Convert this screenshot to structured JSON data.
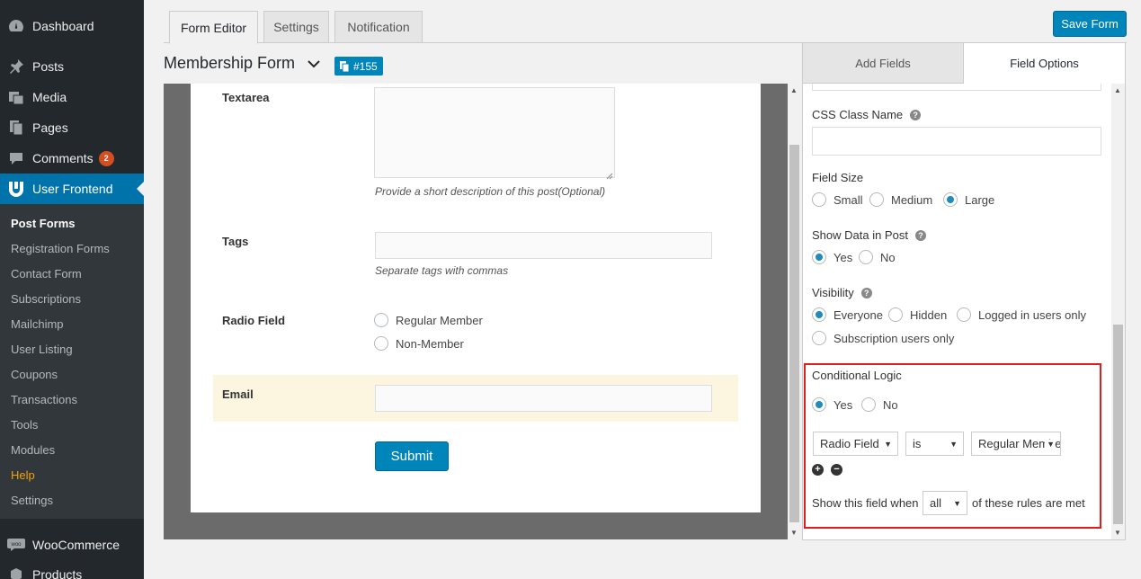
{
  "sidebar": {
    "dashboard": "Dashboard",
    "posts": "Posts",
    "media": "Media",
    "pages": "Pages",
    "comments": "Comments",
    "comments_count": "2",
    "user_frontend": "User Frontend",
    "woocommerce": "WooCommerce",
    "products": "Products",
    "submenu": [
      "Post Forms",
      "Registration Forms",
      "Contact Form",
      "Subscriptions",
      "Mailchimp",
      "User Listing",
      "Coupons",
      "Transactions",
      "Tools",
      "Modules",
      "Help",
      "Settings"
    ]
  },
  "tabs": [
    "Form Editor",
    "Settings",
    "Notification"
  ],
  "save_label": "Save Form",
  "form": {
    "title": "Membership Form",
    "id": "#155"
  },
  "preview": {
    "textarea_label": "Textarea",
    "textarea_help": "Provide a short description of this post(Optional)",
    "tags_label": "Tags",
    "tags_help": "Separate tags with commas",
    "radio_label": "Radio Field",
    "radio_options": [
      "Regular Member",
      "Non-Member"
    ],
    "email_label": "Email",
    "submit_label": "Submit"
  },
  "panel": {
    "tabs": [
      "Add Fields",
      "Field Options"
    ],
    "css_class_label": "CSS Class Name",
    "field_size_label": "Field Size",
    "field_size_options": [
      "Small",
      "Medium",
      "Large"
    ],
    "field_size_selected": "Large",
    "show_data_label": "Show Data in Post",
    "yes": "Yes",
    "no": "No",
    "visibility_label": "Visibility",
    "visibility_options": [
      "Everyone",
      "Hidden",
      "Logged in users only",
      "Subscription users only"
    ],
    "conditional_label": "Conditional Logic",
    "cond_field": "Radio Field",
    "cond_operator": "is",
    "cond_value": "Regular Member",
    "show_when_prefix": "Show this field when",
    "show_when_select": "all",
    "show_when_suffix": "of these rules are met"
  },
  "colors": {
    "accent": "#0085ba",
    "highlight": "#e01e1e",
    "sidebar": "#23282d"
  }
}
